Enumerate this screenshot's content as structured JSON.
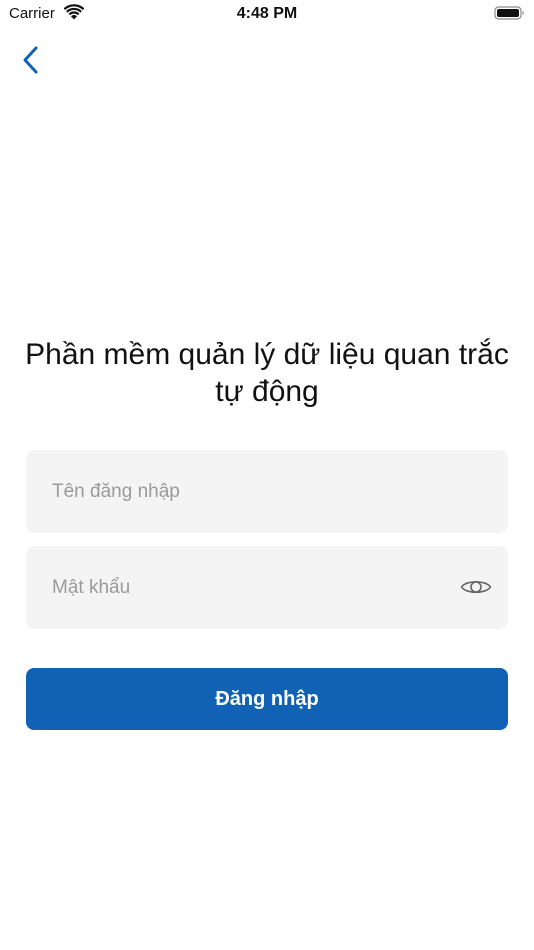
{
  "status_bar": {
    "carrier": "Carrier",
    "time": "4:48 PM",
    "icons": [
      "wifi-icon",
      "battery-icon"
    ]
  },
  "nav": {
    "back_icon": "chevron-left-icon",
    "accent_color": "#1162b5"
  },
  "login": {
    "title": "Phần mềm quản lý dữ liệu quan trắc tự động",
    "username_placeholder": "Tên đăng nhập",
    "username_value": "",
    "password_placeholder": "Mật khẩu",
    "password_value": "",
    "password_toggle_icon": "eye-icon",
    "submit_label": "Đăng nhập",
    "button_color": "#1162b5",
    "field_background": "#f4f4f4"
  }
}
